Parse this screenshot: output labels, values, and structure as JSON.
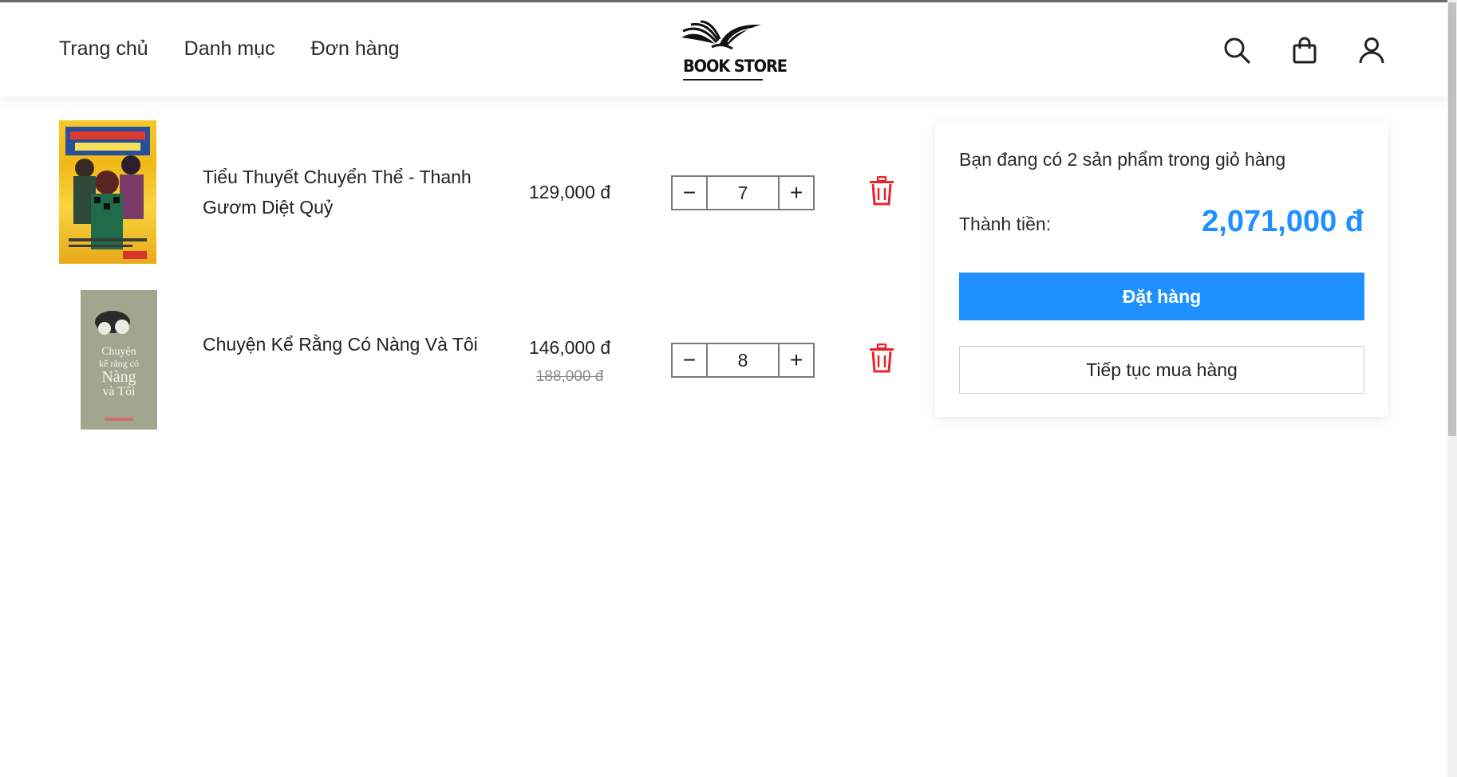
{
  "header": {
    "nav": [
      {
        "label": "Trang chủ"
      },
      {
        "label": "Danh mục"
      },
      {
        "label": "Đơn hàng"
      }
    ],
    "logo_text": "BOOK STORE",
    "icons": [
      "search-icon",
      "shopping-bag-icon",
      "user-icon"
    ]
  },
  "cart": {
    "items": [
      {
        "title": "Tiểu Thuyết Chuyển Thể - Thanh Gươm Diệt Quỷ",
        "price": "129,000 đ",
        "quantity": "7"
      },
      {
        "title": "Chuyện Kể Rằng Có Nàng Và Tôi",
        "price": "146,000 đ",
        "old_price": "188,000 đ",
        "quantity": "8",
        "cover_text": [
          "Chuyện",
          "kể rằng có",
          "Nàng",
          "và Tôi"
        ]
      }
    ],
    "decrement_symbol": "−",
    "increment_symbol": "+"
  },
  "summary": {
    "count_text": "Bạn đang có 2 sản phẩm trong giỏ hàng",
    "total_label": "Thành tiền:",
    "total_value": "2,071,000 đ",
    "order_button": "Đặt hàng",
    "continue_button": "Tiếp tục mua hàng"
  },
  "colors": {
    "accent": "#1e90ff",
    "delete": "#e8232b"
  }
}
